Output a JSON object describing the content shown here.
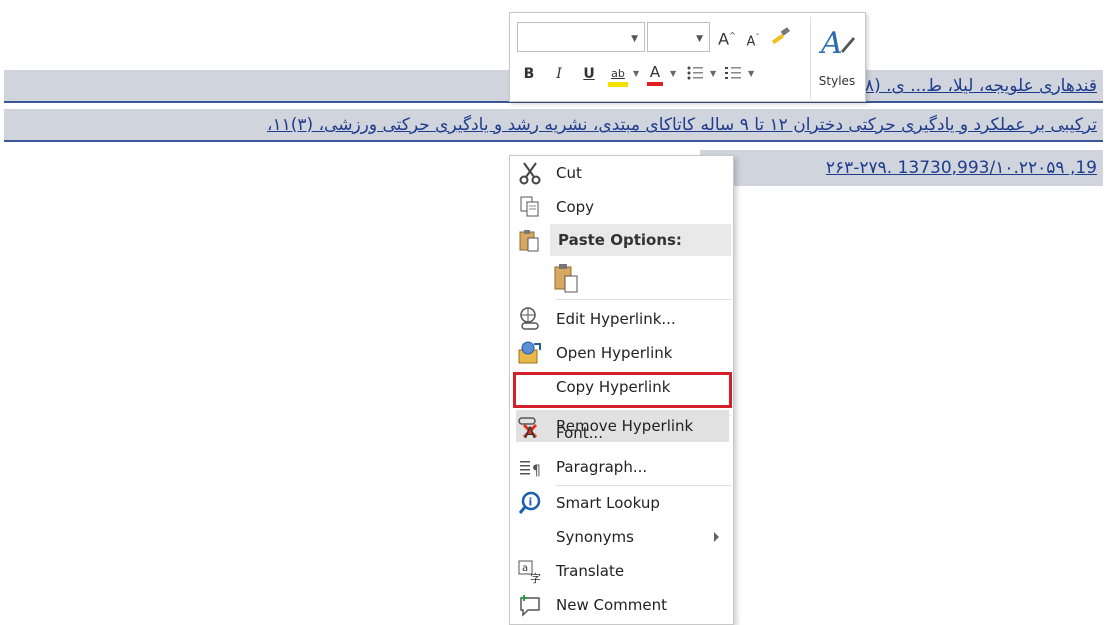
{
  "document": {
    "line1": "قندهاری علویجه، لیلا، ط... ی. (۱۳۹۸). تأثیر تمرینات تقلیدی فوری، دوره ای و",
    "line2": "ترکیبی بر عملکرد و یادگیری حرکتی دختران ۱۲ تا ۹ ساله کاتاکای مبتدی، نشریه رشد و یادگیری حرکتی ورزشی، (۳)۱۱،",
    "line3": "19, 13730,993/۱۰.۲۲۰۵۹ .۲۶۳-۲۷۹"
  },
  "mini_toolbar": {
    "font_name": "",
    "font_size": "",
    "grow_font_icon": "A",
    "shrink_font_icon": "A",
    "bold": "B",
    "italic": "I",
    "underline": "U",
    "highlight_icon": "ab",
    "font_color_icon": "A",
    "styles_label": "Styles"
  },
  "context_menu": {
    "items": [
      {
        "label": "Cut",
        "icon": "scissors-icon"
      },
      {
        "label": "Copy",
        "icon": "copy-icon"
      },
      {
        "label": "Paste Options:",
        "icon": "paste-icon"
      },
      {
        "label": "",
        "icon": "paste-keep-text-icon"
      },
      {
        "label": "Edit Hyperlink...",
        "icon": "edit-hyperlink-icon"
      },
      {
        "label": "Open Hyperlink",
        "icon": "open-hyperlink-icon"
      },
      {
        "label": "Copy Hyperlink",
        "icon": ""
      },
      {
        "label": "Remove Hyperlink",
        "icon": "remove-hyperlink-icon"
      },
      {
        "label": "Font...",
        "icon": "font-icon"
      },
      {
        "label": "Paragraph...",
        "icon": "paragraph-icon"
      },
      {
        "label": "Smart Lookup",
        "icon": "smart-lookup-icon"
      },
      {
        "label": "Synonyms",
        "icon": ""
      },
      {
        "label": "Translate",
        "icon": "translate-icon"
      },
      {
        "label": "New Comment",
        "icon": "new-comment-icon"
      }
    ]
  },
  "colors": {
    "selection": "#d0d4dd",
    "hyperlink_text": "#1f3b8c",
    "highlight_outline": "#d4202a",
    "font_color_bar": "#e02020",
    "highlight_bar": "#f5e000"
  }
}
